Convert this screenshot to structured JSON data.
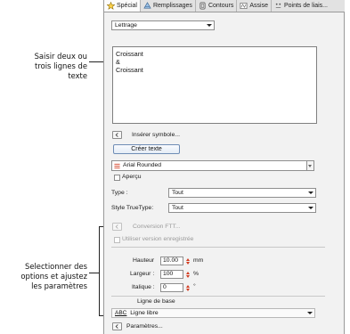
{
  "tabs": [
    {
      "label": "Spécial",
      "icon": "star-icon"
    },
    {
      "label": "Remplissages",
      "icon": "fill-icon"
    },
    {
      "label": "Contours",
      "icon": "outline-icon"
    },
    {
      "label": "Assise",
      "icon": "underlay-icon"
    },
    {
      "label": "Points de liais...",
      "icon": "tie-points-icon"
    }
  ],
  "object_type": {
    "value": "Lettrage"
  },
  "text_input": {
    "lines": [
      "Croissant",
      "&",
      "Croissant"
    ]
  },
  "insert_symbol": {
    "label": "Insérer symbole..."
  },
  "create_text": {
    "label": "Créer texte"
  },
  "font": {
    "value": "Arial Rounded"
  },
  "preview": {
    "label": "Aperçu"
  },
  "type": {
    "label": "Type :",
    "value": "Tout"
  },
  "truetype_style": {
    "label": "Style TrueType:",
    "value": "Tout"
  },
  "ftt_conversion": {
    "label": "Conversion FTT..."
  },
  "saved_version": {
    "label": "Utiliser version enregistrée"
  },
  "height": {
    "label": "Hauteur",
    "value": "10.00",
    "unit": "mm"
  },
  "width": {
    "label": "Largeur :",
    "value": "100",
    "unit": "%"
  },
  "italic": {
    "label": "Italique :",
    "value": "0",
    "unit": "°"
  },
  "baseline": {
    "label": "Ligne de base",
    "value": "Ligne libre",
    "icon_text": "ABC"
  },
  "parameters": {
    "label": "Paramètres..."
  },
  "callouts": {
    "top": [
      "Saisir deux ou",
      "trois lignes de",
      "texte"
    ],
    "bottom": [
      "Selectionner des",
      "options et ajustez",
      "les paramètres"
    ]
  },
  "colors": {
    "spin_arrow": "#d23a1f",
    "font_icon": "#d23a1f",
    "panel_bg": "#f2f2f2"
  }
}
